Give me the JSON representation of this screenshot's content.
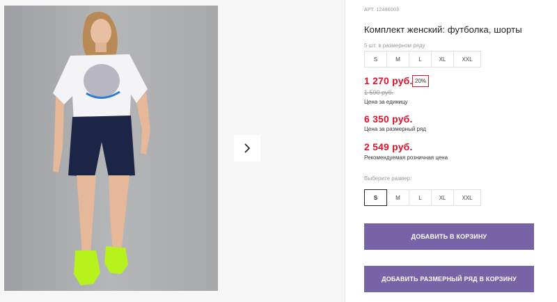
{
  "gallery": {
    "photo_alt": "",
    "next_icon": "chevron-right-icon"
  },
  "product": {
    "article": "АРТ. 12486003",
    "title": "Комплект женский: футболка, шорты",
    "pieces_in_row": "5 шт. в размерном ряду",
    "row_sizes": [
      "S",
      "M",
      "L",
      "XL",
      "XXL"
    ],
    "price": "1 270 руб.",
    "discount": "20%",
    "old_price": "1 590 руб.",
    "price_caption": "Цена за единицу",
    "row_price": "6 350 руб.",
    "row_price_caption": "Цена за размерный ряд",
    "retail_price": "2 549 руб.",
    "retail_caption": "Рекомендуемая розничная цена",
    "choose_size_label": "Выберите размер:",
    "selectable_sizes": [
      "S",
      "M",
      "L",
      "XL",
      "XXL"
    ],
    "selected_size": "S"
  },
  "actions": {
    "add_to_cart": "ДОБАВИТЬ В КОРЗИНУ",
    "add_row_to_cart": "ДОБАВИТЬ РАЗМЕРНЫЙ РЯД В КОРЗИНУ"
  },
  "colors": {
    "price_red": "#e3102a",
    "button_purple": "#7764a6"
  }
}
